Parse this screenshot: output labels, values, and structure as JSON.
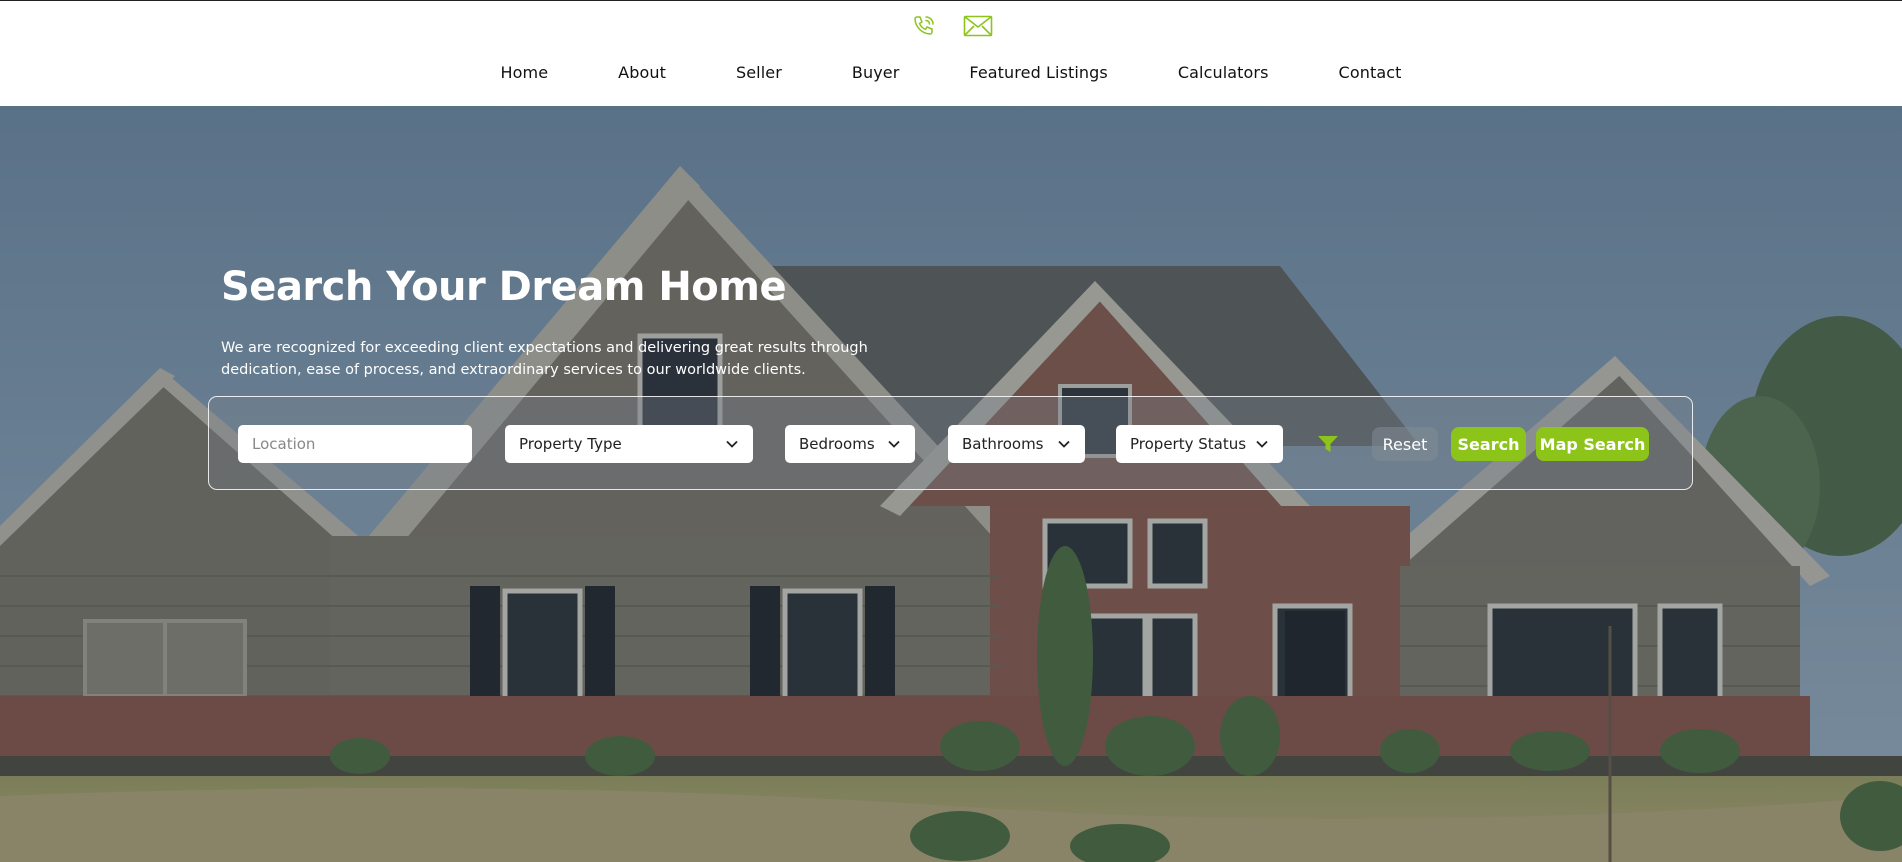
{
  "header": {
    "phone_icon": "phone-icon",
    "email_icon": "mail-icon",
    "accent_color": "#8cc41a",
    "nav": [
      {
        "label": "Home"
      },
      {
        "label": "About"
      },
      {
        "label": "Seller"
      },
      {
        "label": "Buyer"
      },
      {
        "label": "Featured Listings"
      },
      {
        "label": "Calculators"
      },
      {
        "label": "Contact"
      }
    ]
  },
  "hero": {
    "title": "Search Your Dream Home",
    "description": "We are recognized for exceeding client expectations and delivering great results through dedication, ease of process, and extraordinary services to our worldwide clients."
  },
  "search": {
    "location_placeholder": "Location",
    "property_type": "Property Type",
    "bedrooms": "Bedrooms",
    "bathrooms": "Bathrooms",
    "property_status": "Property Status",
    "filter_icon": "filter-icon",
    "reset_label": "Reset",
    "search_label": "Search",
    "map_search_label": "Map Search",
    "button_color": "#8cc41a"
  }
}
